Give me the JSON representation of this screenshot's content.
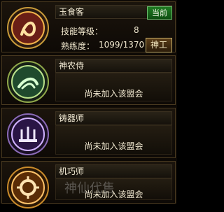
{
  "professions": [
    {
      "name": "玉食客",
      "status_badge": "当前",
      "skill_label": "技能等级：",
      "skill_value": "8",
      "proficiency_label": "熟练度：",
      "proficiency_value": "1099/1370",
      "action_button": "神工"
    },
    {
      "name": "神农侍",
      "status": "尚未加入该盟会"
    },
    {
      "name": "铸器师",
      "status": "尚未加入该盟会"
    },
    {
      "name": "机巧师",
      "status": "尚未加入该盟会"
    }
  ],
  "watermark": "神仙代售"
}
